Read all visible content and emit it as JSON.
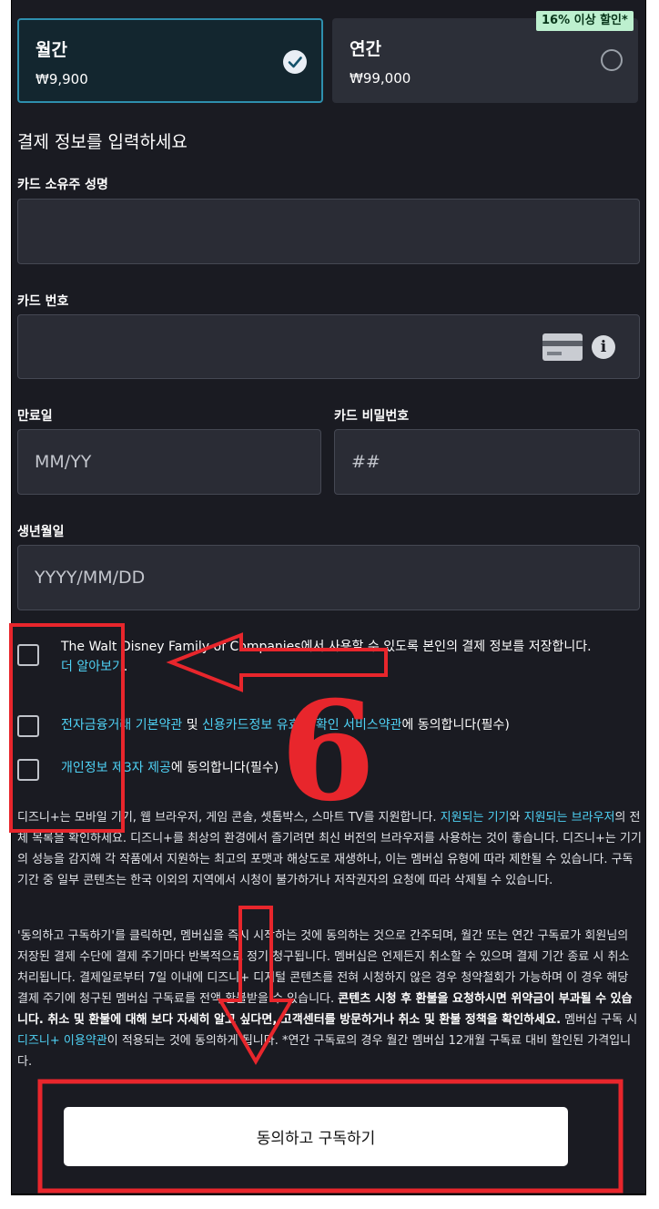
{
  "plans": [
    {
      "name": "월간",
      "price": "₩9,900",
      "selected": true
    },
    {
      "name": "연간",
      "price": "₩99,000",
      "selected": false
    }
  ],
  "discount_badge": "16% 이상 할인*",
  "form": {
    "section_title": "결제 정보를 입력하세요",
    "holder_label": "카드 소유주 성명",
    "holder_value": "",
    "number_label": "카드 번호",
    "number_value": "",
    "expiry_label": "만료일",
    "expiry_placeholder": "MM/YY",
    "cvv_label": "카드 비밀번호",
    "cvv_placeholder": "##",
    "birth_label": "생년월일",
    "birth_placeholder": "YYYY/MM/DD"
  },
  "consents": {
    "save_text": "The Walt Disney Family of Companies에서 사용할 수 있도록 본인의 결제 정보를 저장합니다.",
    "save_link": "더 알아보기",
    "save_tail": ".",
    "terms_link1": "전자금융거래 기본약관",
    "terms_mid": " 및 ",
    "terms_link2": "신용카드정보 유효성 확인 서비스약관",
    "terms_tail": "에 동의합니다(필수)",
    "privacy_link": "개인정보 제3자 제공",
    "privacy_tail": "에 동의합니다(필수)"
  },
  "info": {
    "p1_a": "디즈니+는 모바일 기기, 웹 브라우저, 게임 콘솔, 셋톱박스, 스마트 TV를 지원합니다. ",
    "p1_link1": "지원되는 기기",
    "p1_b": "와 ",
    "p1_link2": "지원되는 브라우저",
    "p1_c": "의 전체 목록을 확인하세요. 디즈니+를 최상의 환경에서 즐기려면 최신 버전의 브라우저를 사용하는 것이 좋습니다. 디즈니+는 기기의 성능을 감지해 각 작품에서 지원하는 최고의 포맷과 해상도로 재생하나, 이는 멤버십 유형에 따라 제한될 수 있습니다. 구독 기간 중 일부 콘텐츠는 한국 이외의 지역에서 시청이 불가하거나 저작권자의 요청에 따라 삭제될 수 있습니다.",
    "p2_a": "'동의하고 구독하기'를 클릭하면, 멤버십을 즉시 시작하는 것에 동의하는 것으로 간주되며, 월간 또는 연간 구독료가 회원님의 저장된 결제 수단에 결제 주기마다 반복적으로 정기 청구됩니다. 멤버십은 언제든지 취소할 수 있으며 결제 기간 종료 시 취소 처리됩니다. 결제일로부터 7일 이내에 디즈니+ 디지털 콘텐츠를 전혀 시청하지 않은 경우 청약철회가 가능하며 이 경우 해당 결제 주기에 청구된 멤버십 구독료를 전액 환불받을 수 있습니다. ",
    "p2_bold1": "콘텐츠 시청 후 환불을 요청하시면 위약금이 부과될 수 있습니다. 취소 및 환불에 대해 보다 자세히 알고 싶다면, 고객센터를 방문하거나 ",
    "p2_link1": "취소 및 환불 정책",
    "p2_bold2": "을 확인하세요.",
    "p2_b": " 멤버십 구독 시 ",
    "p2_link2": "디즈니+ 이용약관",
    "p2_c": "이 적용되는 것에 동의하게 됩니다. *연간 구독료의 경우 월간 멤버십 12개월 구독료 대비 할인된 가격입니다."
  },
  "subscribe_button": "동의하고 구독하기",
  "annotation": {
    "step_number": "6",
    "color": "#e8262c"
  },
  "colors": {
    "background": "#1a1b22",
    "accent_link": "#4fd2f5",
    "selected_border": "#2e8fae"
  }
}
